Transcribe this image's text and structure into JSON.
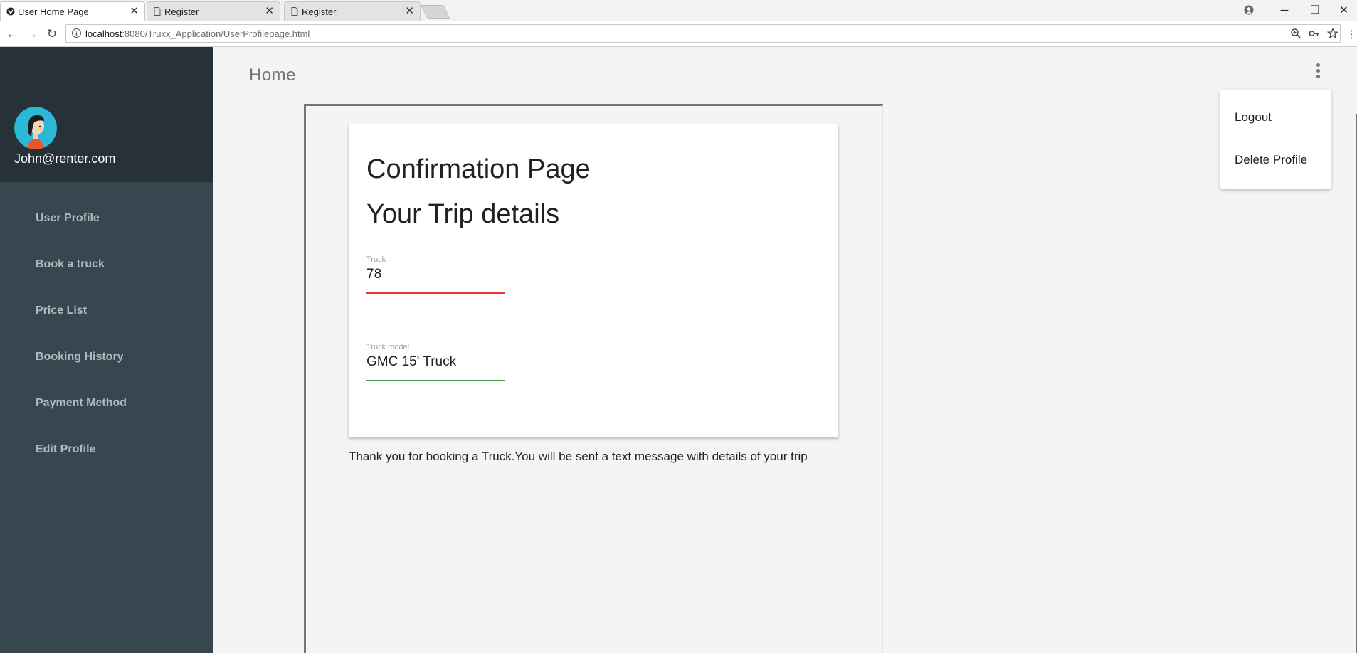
{
  "browser": {
    "tabs": [
      {
        "title": "User Home Page"
      },
      {
        "title": "Register"
      },
      {
        "title": "Register"
      }
    ],
    "url_host": "localhost",
    "url_path": ":8080/Truxx_Application/UserProfilepage.html"
  },
  "sidebar": {
    "user_email": "John@renter.com",
    "items": [
      {
        "label": "User Profile"
      },
      {
        "label": "Book a truck"
      },
      {
        "label": "Price List"
      },
      {
        "label": "Booking History"
      },
      {
        "label": "Payment Method"
      },
      {
        "label": "Edit Profile"
      }
    ]
  },
  "header": {
    "title": "Home"
  },
  "card": {
    "title": "Confirmation Page",
    "subtitle": "Your Trip details",
    "fields": [
      {
        "label": "Truck",
        "value": "78",
        "underline_color": "#e53935"
      },
      {
        "label": "Truck model",
        "value": "GMC 15' Truck",
        "underline_color": "#43a047"
      }
    ]
  },
  "message": "Thank you for booking a Truck.You will be sent a text message with details of your trip",
  "menu": {
    "items": [
      {
        "label": "Logout"
      },
      {
        "label": "Delete Profile"
      }
    ]
  },
  "colors": {
    "sidebar_bg": "#37474f",
    "sidebar_header_bg": "#263238",
    "page_bg": "#f4f4f4"
  }
}
